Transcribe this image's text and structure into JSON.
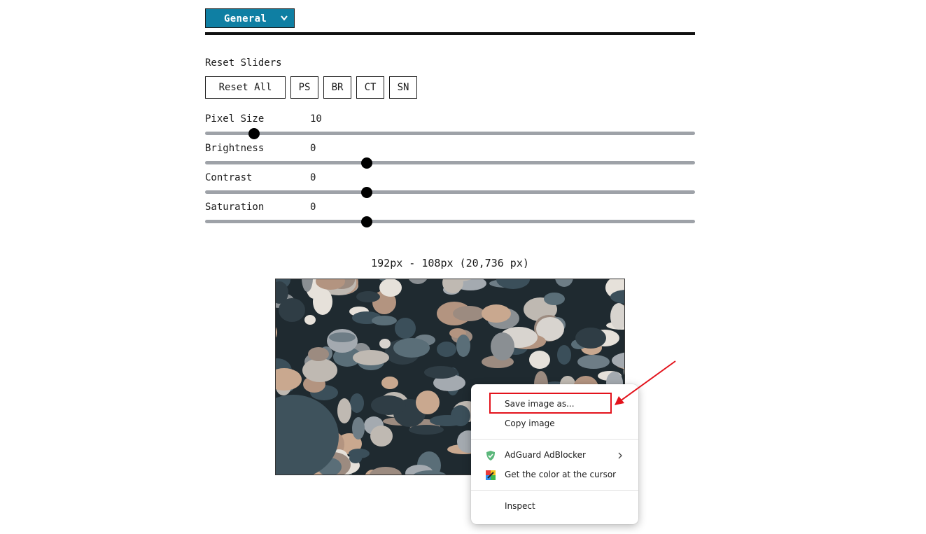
{
  "tab": {
    "label": "General"
  },
  "reset": {
    "title": "Reset Sliders",
    "buttons": [
      "Reset All",
      "PS",
      "BR",
      "CT",
      "SN"
    ]
  },
  "sliders": [
    {
      "label": "Pixel Size",
      "value": "10",
      "fraction": 0.1
    },
    {
      "label": "Brightness",
      "value": "0",
      "fraction": 0.33
    },
    {
      "label": "Contrast",
      "value": "0",
      "fraction": 0.33
    },
    {
      "label": "Saturation",
      "value": "0",
      "fraction": 0.33
    }
  ],
  "image_info": {
    "dimensions": "192px - 108px (20,736 px)"
  },
  "context_menu": {
    "items": [
      {
        "label": "Save image as..."
      },
      {
        "label": "Copy image"
      },
      {
        "label": "AdGuard AdBlocker",
        "icon": "shield-icon",
        "has_submenu": true
      },
      {
        "label": "Get the color at the cursor",
        "icon": "color-picker-icon"
      },
      {
        "label": "Inspect"
      }
    ]
  },
  "colors": {
    "accent": "#0f7fa3",
    "annotation": "#e3131c",
    "track": "#9ea2a8",
    "shield": "#5bb77b"
  }
}
